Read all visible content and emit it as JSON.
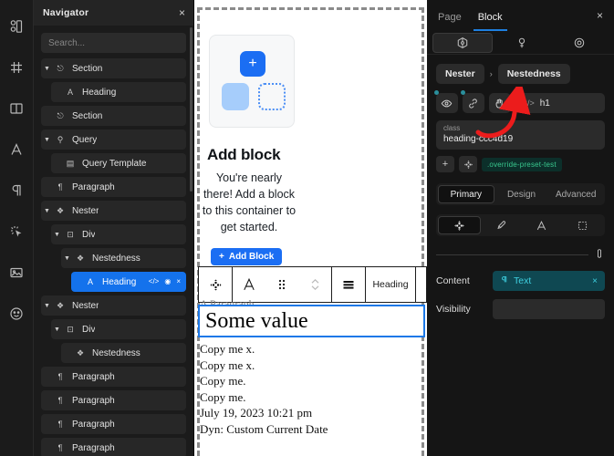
{
  "rail": {
    "items": [
      {
        "name": "blocks-icon"
      },
      {
        "name": "grid-icon"
      },
      {
        "name": "layout-columns-icon"
      },
      {
        "name": "typography-icon"
      },
      {
        "name": "paragraph-icon"
      },
      {
        "name": "effects-icon"
      },
      {
        "name": "image-icon"
      },
      {
        "name": "emoji-icon"
      }
    ]
  },
  "navigator": {
    "title": "Navigator",
    "close_label": "×",
    "search_placeholder": "Search...",
    "tree": [
      {
        "label": "Section",
        "icon": "blocks-icon",
        "indent": 0,
        "caret": "down",
        "selected": false
      },
      {
        "label": "Heading",
        "icon": "text-a-icon",
        "indent": 1,
        "caret": "none",
        "selected": false
      },
      {
        "label": "Section",
        "icon": "blocks-icon",
        "indent": 0,
        "caret": "none",
        "selected": false
      },
      {
        "label": "Query",
        "icon": "search-icon",
        "indent": 0,
        "caret": "down",
        "selected": false
      },
      {
        "label": "Query Template",
        "icon": "template-icon",
        "indent": 1,
        "caret": "none",
        "selected": false
      },
      {
        "label": "Paragraph",
        "icon": "paragraph-icon",
        "indent": 0,
        "caret": "none",
        "selected": false
      },
      {
        "label": "Nester",
        "icon": "nester-icon",
        "indent": 0,
        "caret": "down",
        "selected": false
      },
      {
        "label": "Div",
        "icon": "div-icon",
        "indent": 1,
        "caret": "down",
        "selected": false
      },
      {
        "label": "Nestedness",
        "icon": "nester-icon",
        "indent": 2,
        "caret": "down",
        "selected": false
      },
      {
        "label": "Heading",
        "icon": "text-a-icon",
        "indent": 3,
        "caret": "none",
        "selected": true
      },
      {
        "label": "Nester",
        "icon": "nester-icon",
        "indent": 0,
        "caret": "down",
        "selected": false
      },
      {
        "label": "Div",
        "icon": "div-icon",
        "indent": 1,
        "caret": "down",
        "selected": false
      },
      {
        "label": "Nestedness",
        "icon": "nester-icon",
        "indent": 2,
        "caret": "none",
        "selected": false
      },
      {
        "label": "Paragraph",
        "icon": "paragraph-icon",
        "indent": 0,
        "caret": "none",
        "selected": false
      },
      {
        "label": "Paragraph",
        "icon": "paragraph-icon",
        "indent": 0,
        "caret": "none",
        "selected": false
      },
      {
        "label": "Paragraph",
        "icon": "paragraph-icon",
        "indent": 0,
        "caret": "none",
        "selected": false
      },
      {
        "label": "Paragraph",
        "icon": "paragraph-icon",
        "indent": 0,
        "caret": "none",
        "selected": false
      }
    ],
    "selected_row_actions": [
      "</>",
      "◉",
      "×"
    ]
  },
  "canvas": {
    "placeholder": {
      "plus_glyph": "+",
      "heading": "Add block",
      "body": "You're nearly there! Add a block to this container to get started.",
      "button_label": "Add Block",
      "button_icon": "plus-icon",
      "accent_color": "#1b6ef3"
    },
    "toolbar": {
      "items": [
        {
          "name": "move-handle-icon",
          "label": ""
        },
        {
          "name": "text-format-icon",
          "label": ""
        },
        {
          "name": "drag-dots-icon",
          "label": ""
        },
        {
          "name": "updown-chevron-icon",
          "label": ""
        },
        {
          "name": "align-icon",
          "label": ""
        },
        {
          "name": "heading-select",
          "label": "Heading"
        },
        {
          "name": "link-icon",
          "label": ""
        },
        {
          "name": "more-icon",
          "label": ""
        }
      ]
    },
    "ghost_text": "A Paragraph.",
    "selected_value": "Some value",
    "lines": [
      "Copy me x.",
      "Copy me x.",
      "Copy me.",
      "Copy me.",
      "July 19, 2023 10:21 pm",
      "Dyn: Custom Current Date"
    ]
  },
  "inspector": {
    "tabs": [
      {
        "label": "Page",
        "active": false
      },
      {
        "label": "Block",
        "active": true
      }
    ],
    "close_label": "×",
    "icon_tabs": [
      {
        "name": "block-cube-icon",
        "active": true
      },
      {
        "name": "pin-icon",
        "active": false
      },
      {
        "name": "target-icon",
        "active": false
      }
    ],
    "breadcrumb": {
      "parent": "Nester",
      "separator": "›",
      "current": "Nestedness"
    },
    "tag_buttons": [
      {
        "name": "eye-icon",
        "dot": true
      },
      {
        "name": "link-icon",
        "dot": true
      },
      {
        "name": "hand-icon",
        "dot": false
      }
    ],
    "tag_field": {
      "icon": "</>",
      "value": "h1"
    },
    "class_field": {
      "label": "class",
      "value": "heading-ccc4d19"
    },
    "chips": {
      "add_label": "+",
      "preset_icon": "nester-icon",
      "green_chip": ".override-preset-test",
      "green_color": "#39c98f"
    },
    "segments": [
      {
        "label": "Primary",
        "active": true
      },
      {
        "label": "Design",
        "active": false
      },
      {
        "label": "Advanced",
        "active": false
      }
    ],
    "icon_segments": [
      {
        "name": "layout-diamond-icon",
        "active": true
      },
      {
        "name": "brush-icon",
        "active": false
      },
      {
        "name": "typography-a-icon",
        "active": false
      },
      {
        "name": "spacing-box-icon",
        "active": false
      }
    ],
    "divider_icon": "link-toggle-icon",
    "fields": [
      {
        "label": "Content",
        "value": "Text",
        "icon": "paragraph-icon",
        "filled": true,
        "clear": "×"
      },
      {
        "label": "Visibility",
        "value": "",
        "icon": "",
        "filled": false,
        "clear": ""
      }
    ],
    "accent_teal": "#3fd0e0",
    "accent_blue": "#1e7fe0"
  },
  "annotation": {
    "arrow_color": "#ec1c1c",
    "name": "red-arrow-annotation"
  }
}
